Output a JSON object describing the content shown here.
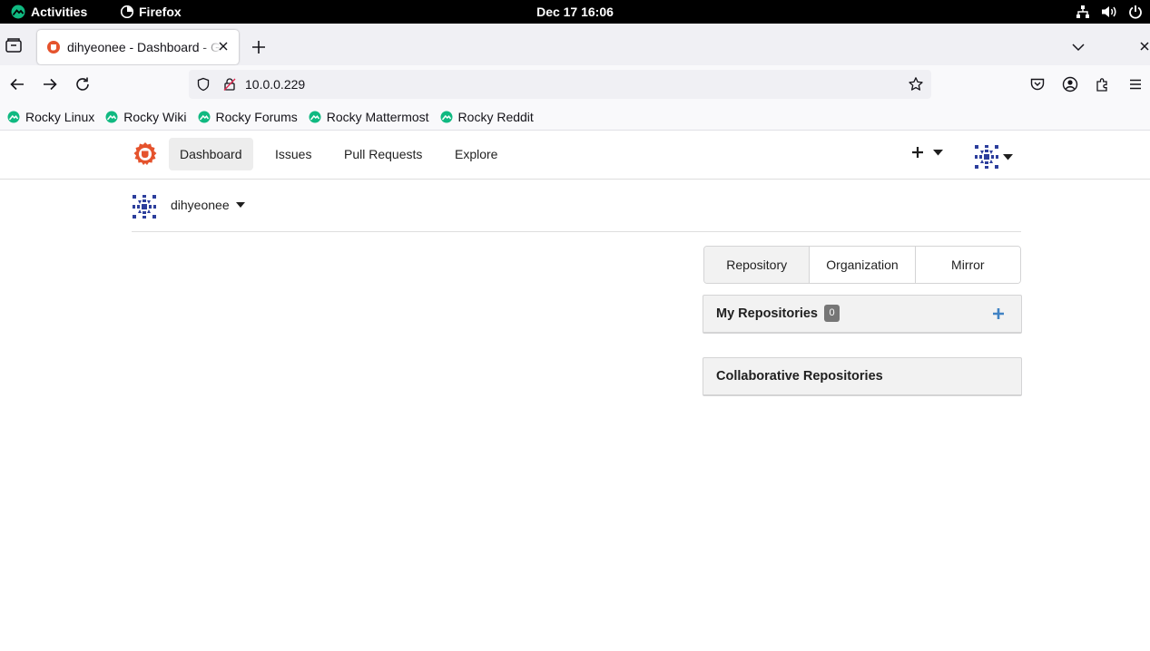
{
  "system_bar": {
    "activities_label": "Activities",
    "app_label": "Firefox",
    "clock": "Dec 17  16:06"
  },
  "browser": {
    "tab_title": "dihyeonee - Dashboard - Gitea",
    "url": "10.0.0.229",
    "bookmarks": [
      "Rocky Linux",
      "Rocky Wiki",
      "Rocky Forums",
      "Rocky Mattermost",
      "Rocky Reddit"
    ]
  },
  "gitea": {
    "nav": [
      "Dashboard",
      "Issues",
      "Pull Requests",
      "Explore"
    ],
    "active_nav": "Dashboard",
    "brand_color": "#e5532d"
  },
  "dashboard": {
    "context_user": "dihyeonee",
    "create_tabs": [
      "Repository",
      "Organization",
      "Mirror"
    ],
    "my_repositories_title": "My Repositories",
    "my_repositories_count": "0",
    "collaborative_title": "Collaborative Repositories"
  }
}
